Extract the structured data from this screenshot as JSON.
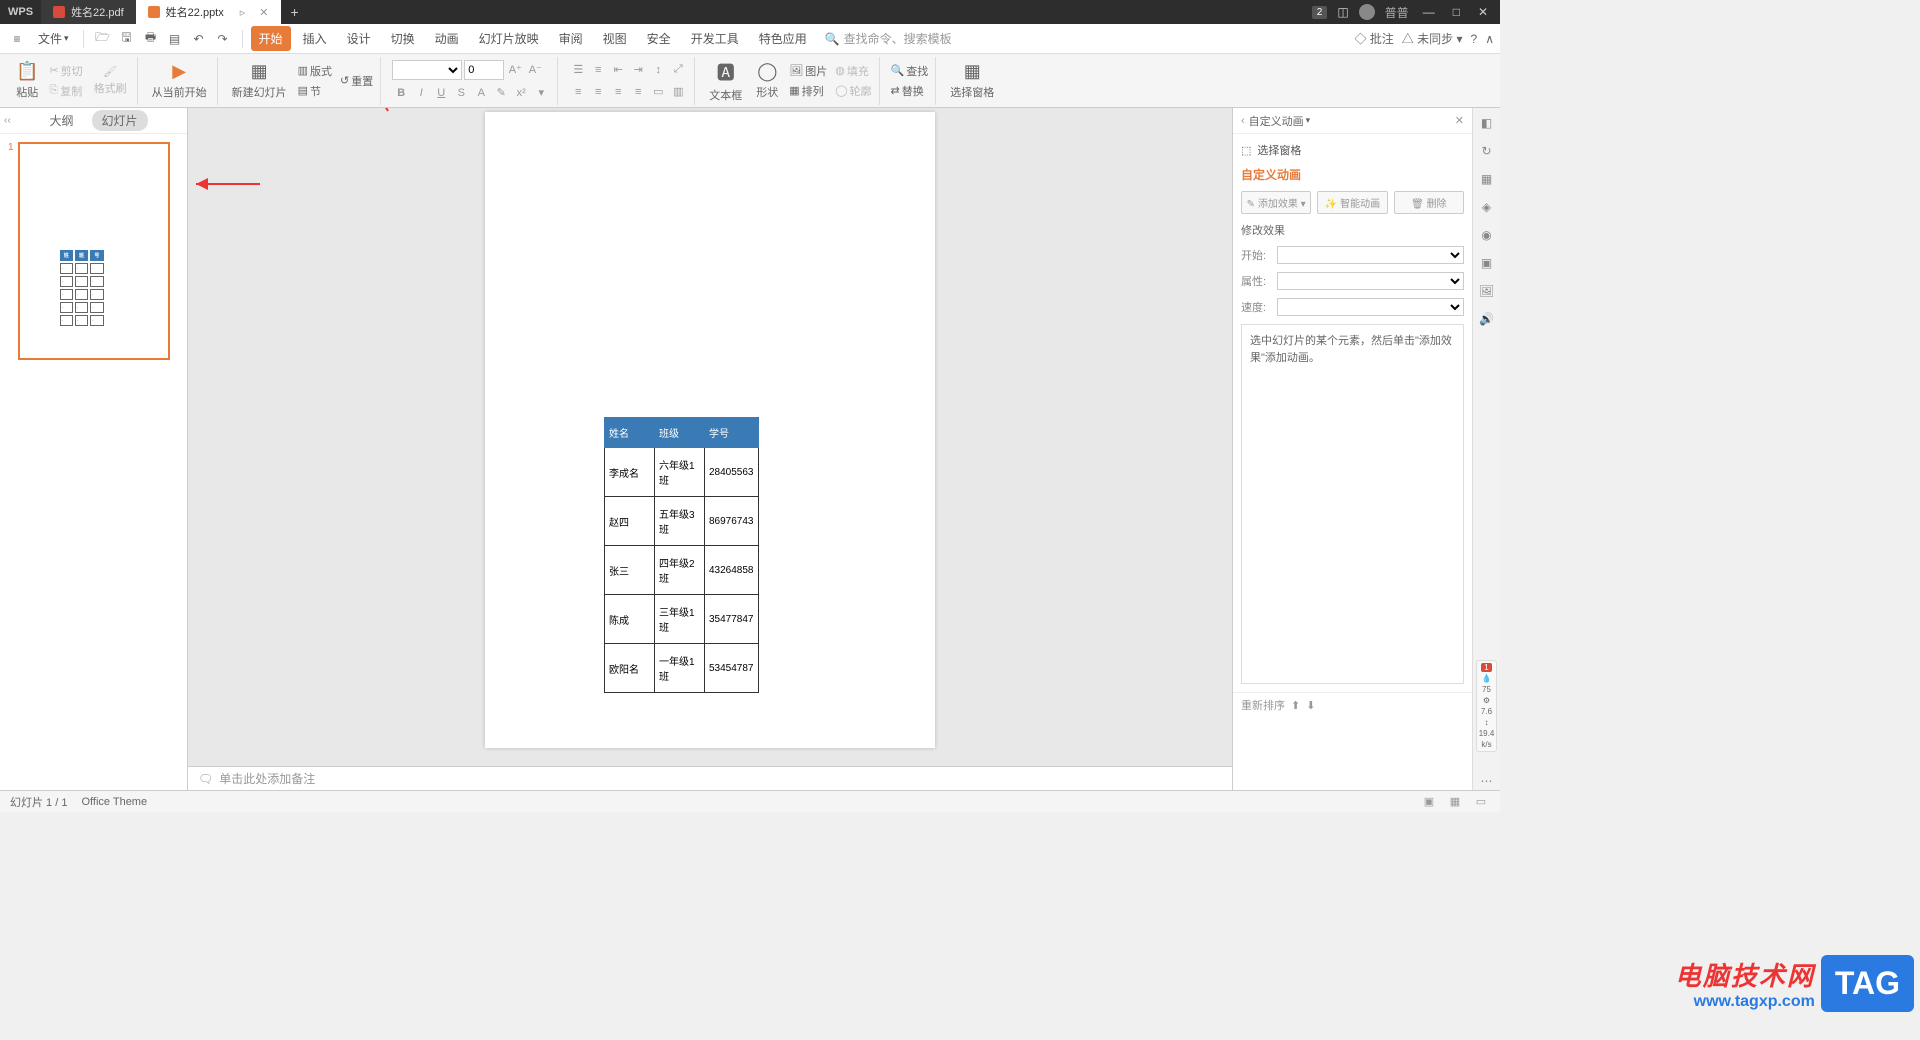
{
  "app": {
    "name": "WPS"
  },
  "tabs": [
    {
      "label": "姓名22.pdf",
      "type": "pdf",
      "active": false
    },
    {
      "label": "姓名22.pptx",
      "type": "ppt",
      "active": true
    }
  ],
  "titleRight": {
    "badge": "2",
    "user": "普普"
  },
  "fileMenu": "文件",
  "menuTabs": [
    "开始",
    "插入",
    "设计",
    "切换",
    "动画",
    "幻灯片放映",
    "审阅",
    "视图",
    "安全",
    "开发工具",
    "特色应用"
  ],
  "activeMenu": "开始",
  "searchPlaceholder": "查找命令、搜索模板",
  "menuRight": {
    "annotate": "批注",
    "sync": "未同步"
  },
  "ribbon": {
    "paste": "粘贴",
    "cut": "剪切",
    "copy": "复制",
    "format": "格式刷",
    "fromCurrent": "从当前开始",
    "newSlide": "新建幻灯片",
    "layout": "版式",
    "reset": "重置",
    "section": "节",
    "fontSize": "0",
    "textbox": "文本框",
    "shape": "形状",
    "arrange": "排列",
    "picture": "图片",
    "replace": "替换",
    "fill": "填充",
    "outline": "轮廓",
    "find": "查找",
    "replaceBtn": "替换",
    "selectPane": "选择窗格"
  },
  "panelTabs": {
    "outline": "大纲",
    "slides": "幻灯片"
  },
  "slideNumber": "1",
  "tableHeaders": [
    "姓名",
    "班级",
    "学号"
  ],
  "tableRows": [
    [
      "李成名",
      "六年级1班",
      "28405563"
    ],
    [
      "赵四",
      "五年级3班",
      "86976743"
    ],
    [
      "张三",
      "四年级2班",
      "43264858"
    ],
    [
      "陈成",
      "三年级1班",
      "35477847"
    ],
    [
      "欧阳名",
      "一年级1班",
      "53454787"
    ]
  ],
  "notesPlaceholder": "单击此处添加备注",
  "rightPane": {
    "title": "自定义动画",
    "selectPane": "选择窗格",
    "sectionTitle": "自定义动画",
    "addEffect": "添加效果",
    "smartAnim": "智能动画",
    "delete": "删除",
    "modifyTitle": "修改效果",
    "startLabel": "开始:",
    "propLabel": "属性:",
    "speedLabel": "速度:",
    "hint": "选中幻灯片的某个元素，然后单击\"添加效果\"添加动画。",
    "reorder": "重新排序"
  },
  "perf": {
    "v1": "75",
    "v2": "7.6",
    "v3": "19.4",
    "unit": "k/s"
  },
  "status": {
    "slideCount": "幻灯片 1 / 1",
    "theme": "Office Theme"
  },
  "watermark": {
    "cn": "电脑技术网",
    "url": "www.tagxp.com",
    "tag": "TAG"
  }
}
